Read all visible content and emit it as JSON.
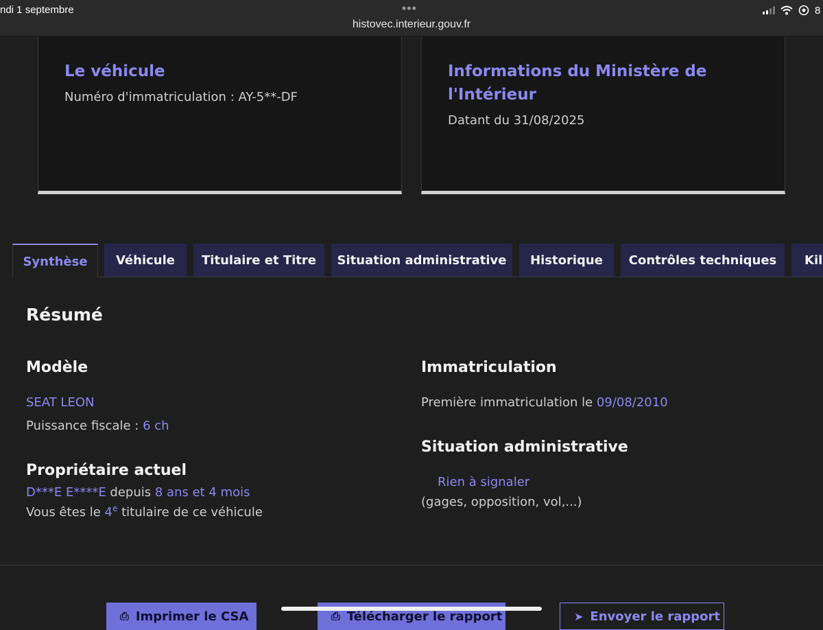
{
  "statusbar": {
    "date": "ndi 1 septembre",
    "dots": "•••",
    "url": "histovec.interieur.gouv.fr",
    "battery": "8"
  },
  "cards": {
    "vehicle": {
      "title": "Le véhicule",
      "plate": "Numéro d'immatriculation : AY-5**-DF"
    },
    "ministry": {
      "title_line1": "Informations du Ministère de",
      "title_line2": "l'Intérieur",
      "date": "Datant du 31/08/2025"
    }
  },
  "tabs": [
    {
      "label": "Synthèse"
    },
    {
      "label": "Véhicule"
    },
    {
      "label": "Titulaire et Titre"
    },
    {
      "label": "Situation administrative"
    },
    {
      "label": "Historique"
    },
    {
      "label": "Contrôles techniques"
    },
    {
      "label": "Kilo"
    }
  ],
  "summary": {
    "heading": "Résumé",
    "model": {
      "heading": "Modèle",
      "name": "SEAT LEON",
      "power_label": "Puissance fiscale : ",
      "power_value": "6 ch"
    },
    "owner": {
      "heading": "Propriétaire actuel",
      "name": "D***E E****E",
      "since_label": " depuis ",
      "since_value": "8 ans et 4 mois",
      "rank_prefix": "Vous êtes le ",
      "rank_number": "4",
      "rank_sup": "e",
      "rank_suffix": " titulaire de ce véhicule"
    },
    "registration": {
      "heading": "Immatriculation",
      "first_label": "Première immatriculation le ",
      "first_date": "09/08/2010"
    },
    "admin": {
      "heading": "Situation administrative",
      "status": "Rien à signaler",
      "note": "(gages, opposition, vol,...)"
    }
  },
  "buttons": {
    "print": "Imprimer le CSA",
    "download": "Télécharger le rapport",
    "send": "Envoyer le rapport"
  }
}
